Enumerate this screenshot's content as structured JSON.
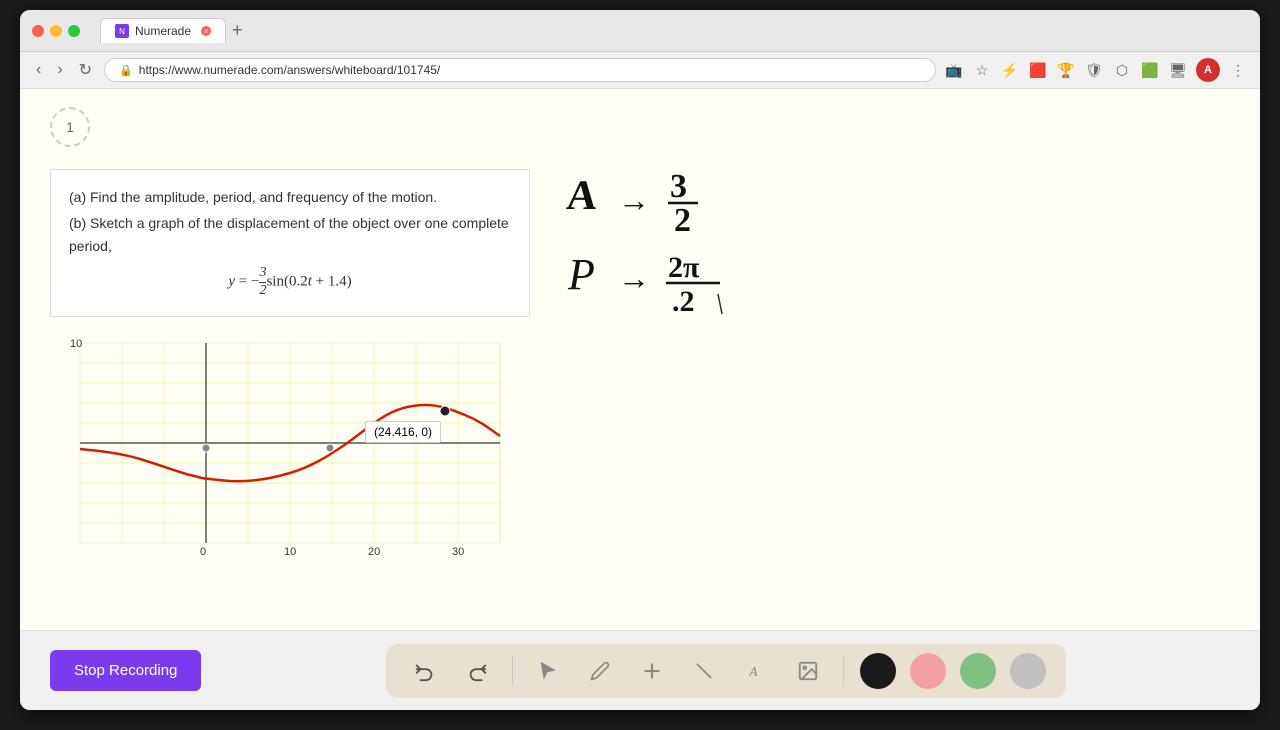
{
  "browser": {
    "tab_title": "Numerade",
    "tab_favicon": "N",
    "url": "https://www.numerade.com/answers/whiteboard/101745/",
    "new_tab_label": "+",
    "profile_label": "A"
  },
  "slide": {
    "number": "1"
  },
  "problem": {
    "line1": "(a) Find the amplitude, period, and frequency of the motion.",
    "line2": "(b) Sketch a graph of the displacement of the object over one complete period,",
    "equation": "y = −(3/2)sin(0.2t + 1.4)"
  },
  "graph": {
    "tooltip_text": "(24.416, 0)",
    "x_labels": [
      "0",
      "10",
      "20",
      "30"
    ],
    "y_label_top": "10"
  },
  "annotations": {
    "label_A": "A →",
    "value_A": "3/2",
    "label_P": "P →",
    "value_P": "2π/.2"
  },
  "toolbar": {
    "stop_recording_label": "Stop Recording",
    "tools": [
      {
        "name": "undo",
        "icon": "↩",
        "label": "Undo"
      },
      {
        "name": "redo",
        "icon": "↪",
        "label": "Redo"
      },
      {
        "name": "select",
        "icon": "▲",
        "label": "Select"
      },
      {
        "name": "pen",
        "icon": "✏",
        "label": "Pen"
      },
      {
        "name": "add",
        "icon": "+",
        "label": "Add"
      },
      {
        "name": "eraser",
        "icon": "/",
        "label": "Eraser"
      },
      {
        "name": "text",
        "icon": "A",
        "label": "Text"
      },
      {
        "name": "image",
        "icon": "🖼",
        "label": "Image"
      }
    ],
    "colors": [
      {
        "name": "black",
        "value": "#1a1a1a"
      },
      {
        "name": "pink",
        "value": "#f4a0a0"
      },
      {
        "name": "green",
        "value": "#80c080"
      },
      {
        "name": "gray",
        "value": "#c0c0c0"
      }
    ]
  }
}
